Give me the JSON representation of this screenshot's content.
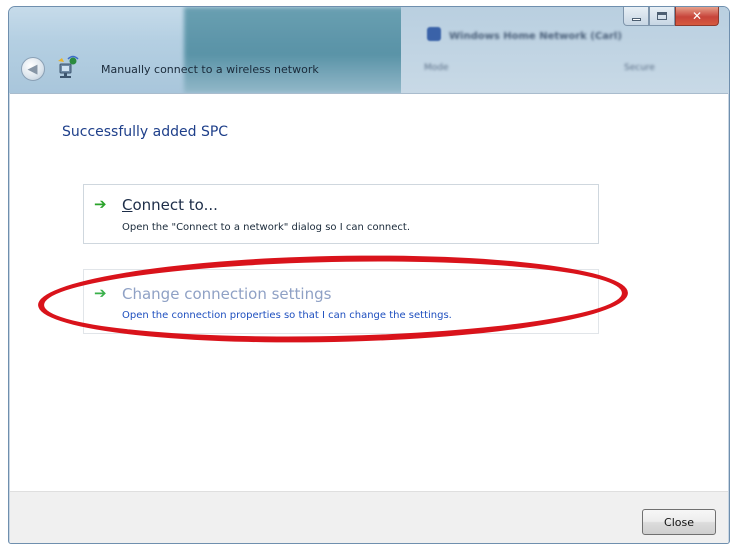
{
  "window": {
    "title": "Manually connect to a wireless network",
    "background_window_title": "Windows Home Network (Carl)",
    "background_col1": "Mode",
    "background_col2": "Secure"
  },
  "caption": {
    "minimize_icon": "minimize-icon",
    "maximize_icon": "maximize-icon",
    "close_glyph": "✕"
  },
  "nav": {
    "back_icon": "back-arrow-icon",
    "back_glyph": "◀"
  },
  "content": {
    "heading": "Successfully added SPC",
    "commands": [
      {
        "arrow": "➔",
        "title_underlined": "C",
        "title_rest": "onnect to...",
        "description": "Open the \"Connect to a network\" dialog so I can connect."
      },
      {
        "arrow": "➔",
        "title_underlined": "",
        "title_rest": "Change connection settings",
        "description": "Open the connection properties so that I can change the settings."
      }
    ]
  },
  "annotation": {
    "color": "#d9131b"
  },
  "footer": {
    "close_label": "Close"
  },
  "colors": {
    "heading": "#1e3f8a",
    "link_blue": "#1e4fbf",
    "arrow_green": "#2aa32a"
  }
}
